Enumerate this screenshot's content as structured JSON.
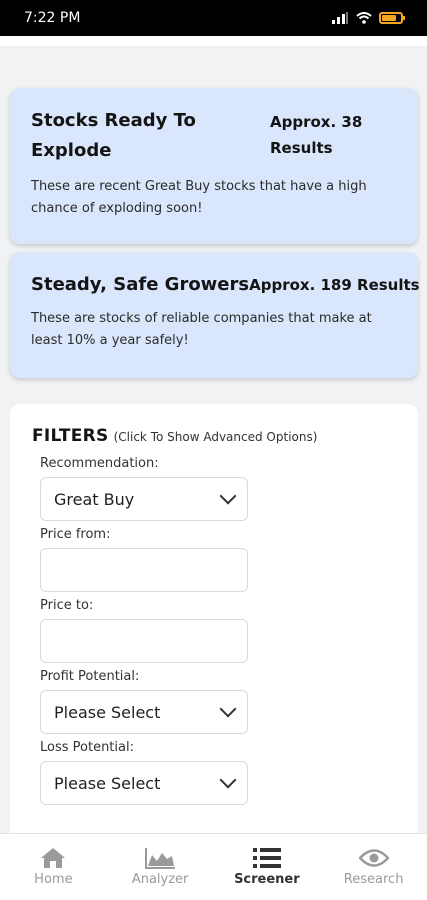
{
  "status_bar": {
    "time": "7:22 PM"
  },
  "cards": [
    {
      "title": "Stocks Ready To Explode",
      "results": "Approx. 38 Results",
      "description": "These are recent Great Buy stocks that have a high chance of exploding soon!"
    },
    {
      "title": "Steady, Safe Growers",
      "results": "Approx. 189 Results",
      "description": "These are stocks of reliable companies that make at least 10% a year safely!"
    }
  ],
  "filters": {
    "title": "FILTERS",
    "hint": "(Click To Show Advanced Options)",
    "recommendation": {
      "label": "Recommendation:",
      "value": "Great Buy"
    },
    "price_from": {
      "label": "Price from:",
      "value": ""
    },
    "price_to": {
      "label": "Price to:",
      "value": ""
    },
    "profit_potential": {
      "label": "Profit Potential:",
      "value": "Please Select"
    },
    "loss_potential": {
      "label": "Loss Potential:",
      "value": "Please Select"
    }
  },
  "bottom_nav": [
    {
      "label": "Home",
      "icon": "home-icon"
    },
    {
      "label": "Analyzer",
      "icon": "chart-icon"
    },
    {
      "label": "Screener",
      "icon": "list-icon",
      "active": true
    },
    {
      "label": "Research",
      "icon": "eye-icon"
    }
  ]
}
